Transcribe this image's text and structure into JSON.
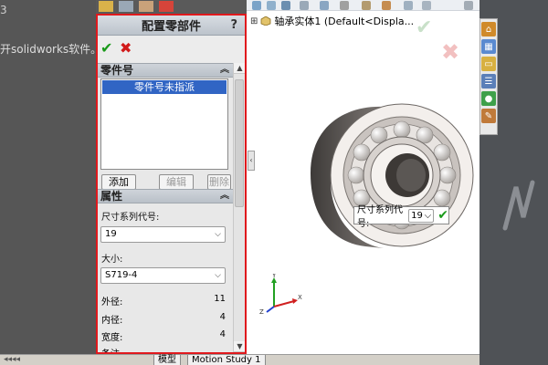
{
  "background": {
    "left_number": "3",
    "left_text": "开solidworks软件。"
  },
  "viewport": {
    "tree_label": "轴承实体1  (Default<Displa...",
    "callout": {
      "label": "尺寸系列代号:",
      "value": "19"
    }
  },
  "bottom_tabs": {
    "model": "模型",
    "motion": "Motion Study 1"
  },
  "panel": {
    "title": "配置零部件",
    "help": "?",
    "part_number_group": {
      "title": "零件号",
      "selected_item": "零件号未指派",
      "buttons": {
        "add": "添加",
        "edit": "编辑",
        "delete": "删除"
      }
    },
    "properties_group": {
      "title": "属性",
      "size_series_label": "尺寸系列代号:",
      "size_series_value": "19",
      "size_label": "大小:",
      "size_value": "S719-4",
      "rows": [
        {
          "label": "外径:",
          "value": "11"
        },
        {
          "label": "内径:",
          "value": "4"
        },
        {
          "label": "宽度:",
          "value": "4"
        },
        {
          "label": "备注:",
          "value": ""
        }
      ]
    }
  },
  "colors": {
    "highlight_border": "#e0191d",
    "selection": "#3165c4",
    "ok_green": "#1a9a1a",
    "cancel_red": "#d11a1a"
  }
}
